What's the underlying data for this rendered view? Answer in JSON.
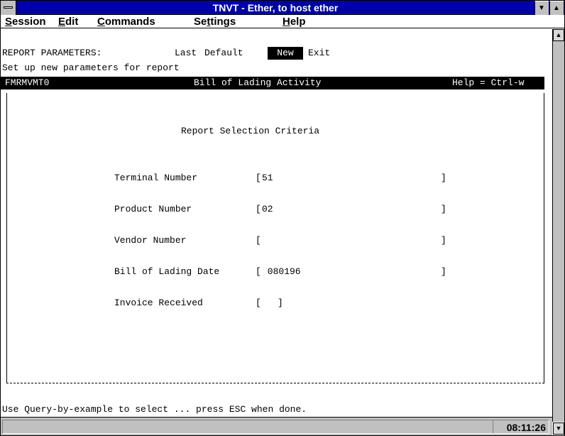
{
  "window": {
    "title": "TNVT - Ether, to host ether"
  },
  "titlebar_buttons": {
    "minimize_glyph": "▼",
    "maximize_glyph": "▲"
  },
  "menu": {
    "items": [
      {
        "underline": "S",
        "rest": "ession"
      },
      {
        "underline": "E",
        "rest": "dit"
      },
      {
        "underline": "C",
        "rest": "ommands"
      },
      {
        "pre": "Se",
        "underline": "t",
        "rest": "tings"
      },
      {
        "underline": "H",
        "rest": "elp"
      }
    ]
  },
  "report_menu": {
    "label": "REPORT PARAMETERS:",
    "options": [
      "Last",
      "Default",
      "New",
      "Exit"
    ],
    "selected": "New"
  },
  "prompt": "Set up new parameters for report",
  "form_header": {
    "form_id": "FMRMVMT0",
    "form_title": "Bill of Lading Activity",
    "help_hint": "Help = Ctrl-w"
  },
  "form": {
    "heading": "Report Selection Criteria",
    "fields": [
      {
        "label": "Terminal Number",
        "value": "51"
      },
      {
        "label": "Product Number",
        "value": "02"
      },
      {
        "label": "Vendor Number",
        "value": ""
      },
      {
        "label": "Bill of Lading Date",
        "value": " 080196"
      }
    ],
    "invoice": {
      "label": "Invoice Received",
      "value": " "
    }
  },
  "footer_message": "Use Query-by-example to select ... press ESC when done.",
  "status": {
    "clock": "08:11:26"
  },
  "scrollbar": {
    "up_glyph": "▲",
    "down_glyph": "▼"
  }
}
